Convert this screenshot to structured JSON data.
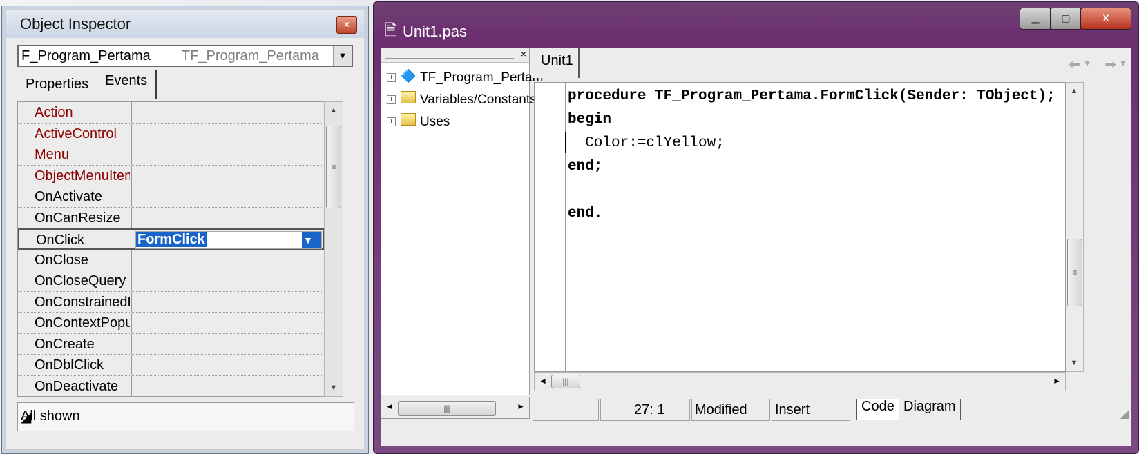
{
  "object_inspector": {
    "title": "Object Inspector",
    "close_glyph": "×",
    "component_name": "F_Program_Pertama",
    "component_type": "TF_Program_Pertama",
    "tabs": [
      "Properties",
      "Events"
    ],
    "active_tab": "Events",
    "events": [
      {
        "name": "Action",
        "color": "#8b0000"
      },
      {
        "name": "ActiveControl",
        "color": "#8b0000"
      },
      {
        "name": "Menu",
        "color": "#8b0000"
      },
      {
        "name": "ObjectMenuItem",
        "color": "#8b0000"
      },
      {
        "name": "OnActivate",
        "color": "#000000"
      },
      {
        "name": "OnCanResize",
        "color": "#000000"
      },
      {
        "name": "OnClick",
        "color": "#000000",
        "value": "FormClick"
      },
      {
        "name": "OnClose",
        "color": "#000000"
      },
      {
        "name": "OnCloseQuery",
        "color": "#000000"
      },
      {
        "name": "OnConstrainedResize",
        "color": "#000000"
      },
      {
        "name": "OnContextPopup",
        "color": "#000000"
      },
      {
        "name": "OnCreate",
        "color": "#000000"
      },
      {
        "name": "OnDblClick",
        "color": "#000000"
      },
      {
        "name": "OnDeactivate",
        "color": "#000000"
      }
    ],
    "selected_value": "FormClick",
    "status": "All shown"
  },
  "editor": {
    "title": "Unit1.pas",
    "tree": [
      {
        "label": "TF_Program_Pertam",
        "icon": "component-icon"
      },
      {
        "label": "Variables/Constants",
        "icon": "folder-icon"
      },
      {
        "label": "Uses",
        "icon": "folder-icon"
      }
    ],
    "tab": "Unit1",
    "code_lines": [
      "procedure TF_Program_Pertama.FormClick(Sender: TObject);",
      "begin",
      "  Color:=clYellow;",
      "end;",
      "",
      "end."
    ],
    "status": {
      "position": "27:  1",
      "modified": "Modified",
      "mode": "Insert"
    },
    "view_tabs": [
      "Code",
      "Diagram"
    ]
  },
  "colors": {
    "highlight": "#1864c8",
    "window_frame": "#6c2f70"
  }
}
